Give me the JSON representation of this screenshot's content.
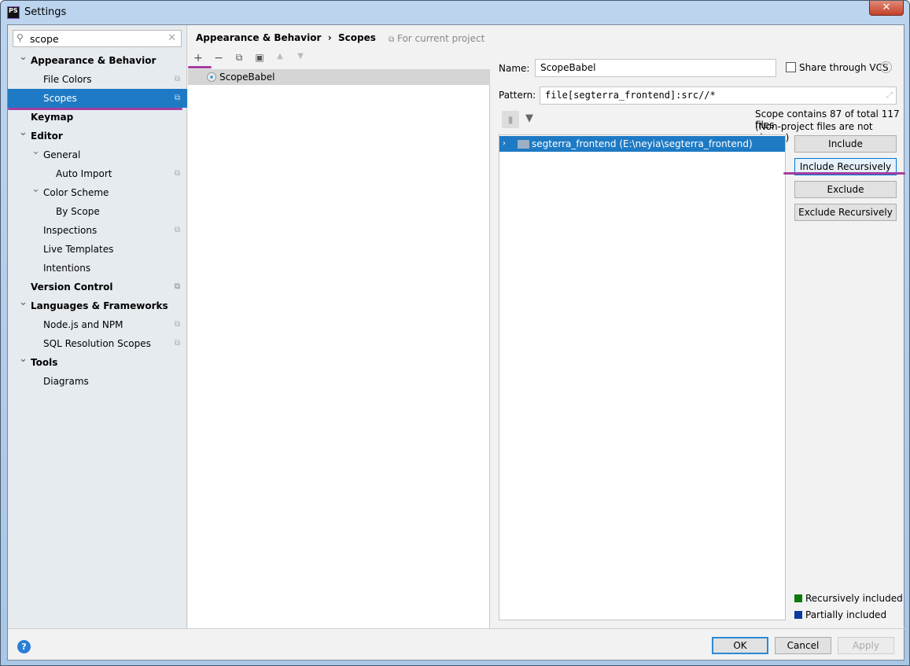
{
  "window": {
    "title": "Settings",
    "app_icon": "PS",
    "close_label": "✕"
  },
  "search": {
    "value": "scope"
  },
  "sidebar": {
    "items": [
      {
        "label": "Appearance & Behavior",
        "level": 0,
        "bold": true,
        "expanded": true
      },
      {
        "label": "File Colors",
        "level": 1,
        "copy": true
      },
      {
        "label": "Scopes",
        "level": 1,
        "copy": true,
        "selected": true
      },
      {
        "label": "Keymap",
        "level": 0,
        "bold": true
      },
      {
        "label": "Editor",
        "level": 0,
        "bold": true,
        "expanded": true
      },
      {
        "label": "General",
        "level": 1,
        "expanded": true
      },
      {
        "label": "Auto Import",
        "level": 2,
        "copy": true
      },
      {
        "label": "Color Scheme",
        "level": 1,
        "expanded": true
      },
      {
        "label": "By Scope",
        "level": 2
      },
      {
        "label": "Inspections",
        "level": 1,
        "copy": true
      },
      {
        "label": "Live Templates",
        "level": 1
      },
      {
        "label": "Intentions",
        "level": 1
      },
      {
        "label": "Version Control",
        "level": 0,
        "bold": true,
        "copy": true
      },
      {
        "label": "Languages & Frameworks",
        "level": 0,
        "bold": true,
        "expanded": true
      },
      {
        "label": "Node.js and NPM",
        "level": 1,
        "copy": true
      },
      {
        "label": "SQL Resolution Scopes",
        "level": 1,
        "copy": true
      },
      {
        "label": "Tools",
        "level": 0,
        "bold": true,
        "expanded": true
      },
      {
        "label": "Diagrams",
        "level": 1
      }
    ]
  },
  "breadcrumb": {
    "parent": "Appearance & Behavior",
    "sep": "›",
    "current": "Scopes",
    "for_project": "For current project"
  },
  "scopes": [
    "ScopeBabel"
  ],
  "form": {
    "name_label": "Name:",
    "name_value": "ScopeBabel",
    "share_label": "Share through VCS",
    "share_checked": false,
    "pattern_label": "Pattern:",
    "pattern_value": "file[segterra_frontend]:src//*",
    "scope_info": "Scope contains 87 of total 117 files",
    "non_project": "(Non-project files are not shown)"
  },
  "tree": {
    "root": "segterra_frontend (E:\\neyia\\segterra_frontend)"
  },
  "buttons": {
    "include": "Include",
    "include_rec": "Include Recursively",
    "exclude": "Exclude",
    "exclude_rec": "Exclude Recursively"
  },
  "legend": [
    {
      "label": "Recursively included",
      "color": "#0a7a0a"
    },
    {
      "label": "Partially included",
      "color": "#0a3aa0"
    }
  ],
  "footer": {
    "ok": "OK",
    "cancel": "Cancel",
    "apply": "Apply",
    "help": "?"
  },
  "highlight_color": "#a23fa0"
}
